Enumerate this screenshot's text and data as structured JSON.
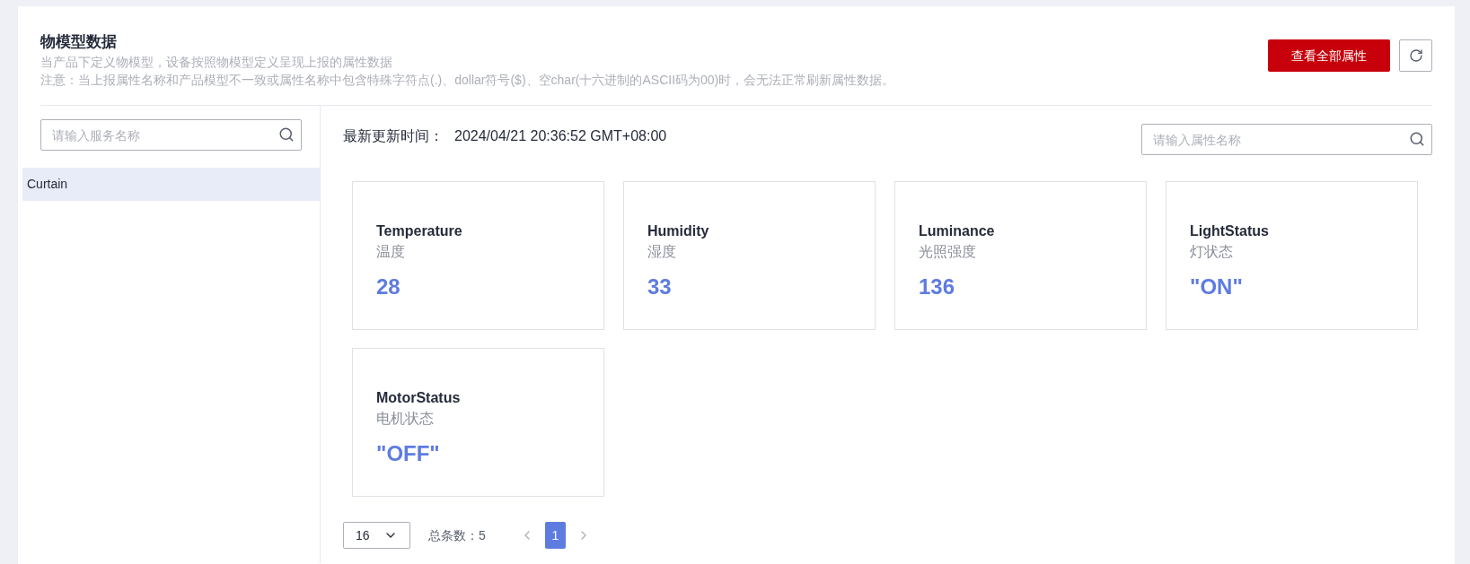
{
  "header": {
    "title": "物模型数据",
    "description": "当产品下定义物模型，设备按照物模型定义呈现上报的属性数据",
    "notice": "注意：当上报属性名称和产品模型不一致或属性名称中包含特殊字符点(.)、dollar符号($)、空char(十六进制的ASCII码为00)时，会无法正常刷新属性数据。",
    "view_all_button": "查看全部属性"
  },
  "sidebar": {
    "search": {
      "placeholder": "请输入服务名称"
    },
    "items": [
      {
        "label": "Curtain",
        "selected": true
      }
    ]
  },
  "update_time": {
    "label": "最新更新时间：",
    "value": "2024/04/21 20:36:52 GMT+08:00"
  },
  "property_search": {
    "placeholder": "请输入属性名称"
  },
  "properties": [
    {
      "name": "Temperature",
      "label": "温度",
      "value": "28"
    },
    {
      "name": "Humidity",
      "label": "湿度",
      "value": "33"
    },
    {
      "name": "Luminance",
      "label": "光照强度",
      "value": "136"
    },
    {
      "name": "LightStatus",
      "label": "灯状态",
      "value": "\"ON\""
    },
    {
      "name": "MotorStatus",
      "label": "电机状态",
      "value": "\"OFF\""
    }
  ],
  "pagination": {
    "page_size": "16",
    "total": "总条数：5",
    "pages": [
      {
        "label": "1",
        "selected": true
      }
    ]
  }
}
